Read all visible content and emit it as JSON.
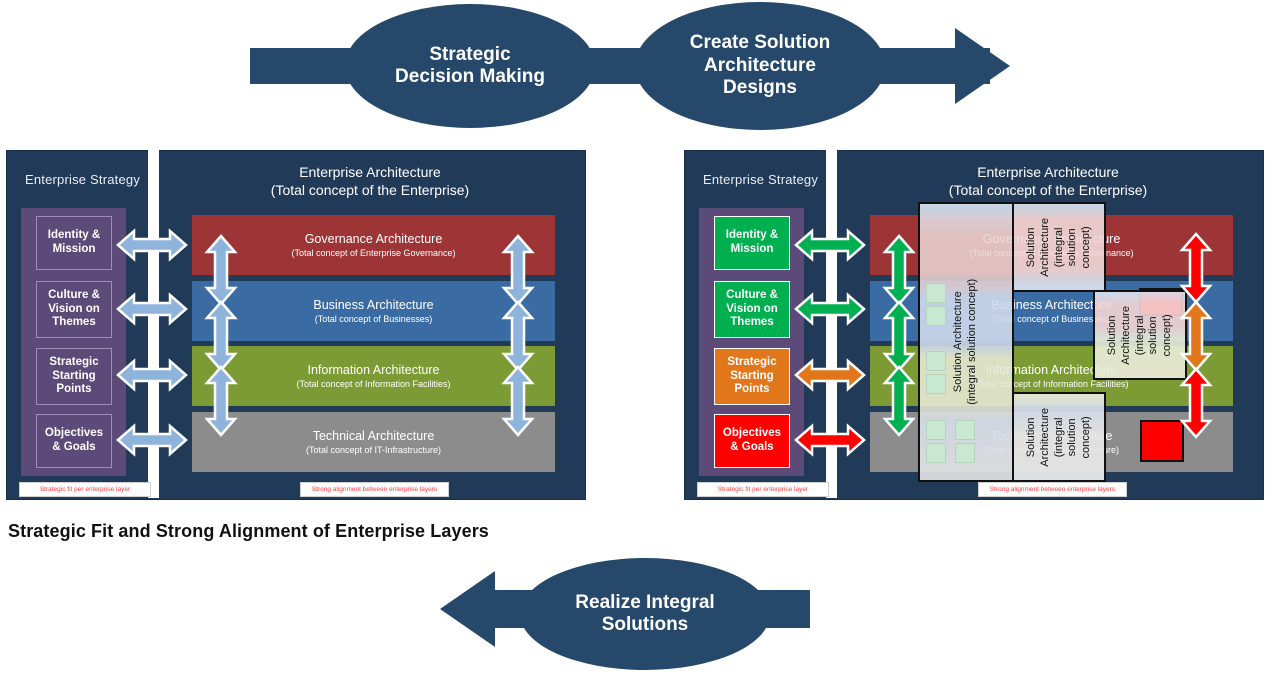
{
  "process": {
    "top": {
      "step1": "Strategic\nDecision Making",
      "step1_line1": "Strategic",
      "step1_line2": "Decision Making",
      "step2_line1": "Create Solution",
      "step2_line2": "Architecture",
      "step2_line3": "Designs",
      "color": "#26486b"
    },
    "bottom": {
      "line1": "Realize Integral",
      "line2": "Solutions",
      "color": "#26486b"
    }
  },
  "caption": "Strategic Fit and Strong Alignment of Enterprise Layers",
  "panels": {
    "left": {
      "strategy_title": "Enterprise Strategy",
      "ea_title_line1": "Enterprise Architecture",
      "ea_title_line2": "(Total concept of the Enterprise)",
      "strategy_items": [
        {
          "label_line1": "Identity &",
          "label_line2": "Mission",
          "color": "transparent"
        },
        {
          "label_line1": "Culture &",
          "label_line2": "Vision on",
          "label_line3": "Themes",
          "color": "transparent"
        },
        {
          "label_line1": "Strategic",
          "label_line2": "Starting",
          "label_line3": "Points",
          "color": "transparent"
        },
        {
          "label_line1": "Objectives",
          "label_line2": "& Goals",
          "color": "transparent"
        }
      ],
      "layers": [
        {
          "title": "Governance Architecture",
          "subtitle": "(Total concept of Enterprise Governance)",
          "color": "#9d3536"
        },
        {
          "title": "Business Architecture",
          "subtitle": "(Total concept of Businesses)",
          "color": "#3a6ca3"
        },
        {
          "title": "Information Architecture",
          "subtitle": "(Total concept of Information Facilities)",
          "color": "#7d9b35"
        },
        {
          "title": "Technical Architecture",
          "subtitle": "(Total concept of IT-Infrastructure)",
          "color": "#8c8c8c"
        }
      ],
      "h_arrow_colors": [
        "#8fb4dc",
        "#8fb4dc",
        "#8fb4dc",
        "#8fb4dc"
      ],
      "v_arrow_colors_left": [
        "#8fb4dc",
        "#8fb4dc",
        "#8fb4dc"
      ],
      "v_arrow_colors_right": [
        "#8fb4dc",
        "#8fb4dc",
        "#8fb4dc"
      ],
      "note_strategy": "Strategic fit per enterprise layer",
      "note_alignment": "Strong alignment between enterprise layers"
    },
    "right": {
      "strategy_title": "Enterprise Strategy",
      "ea_title_line1": "Enterprise Architecture",
      "ea_title_line2": "(Total concept of the Enterprise)",
      "strategy_items": [
        {
          "label_line1": "Identity &",
          "label_line2": "Mission",
          "color": "#00b050"
        },
        {
          "label_line1": "Culture &",
          "label_line2": "Vision on",
          "label_line3": "Themes",
          "color": "#00b050"
        },
        {
          "label_line1": "Strategic",
          "label_line2": "Starting",
          "label_line3": "Points",
          "color": "#e1761a"
        },
        {
          "label_line1": "Objectives",
          "label_line2": "& Goals",
          "color": "#ff0000"
        }
      ],
      "layers": [
        {
          "title": "Governance Architecture",
          "subtitle": "(Total concept of Enterprise Governance)",
          "color": "#9d3536"
        },
        {
          "title": "Business Architecture",
          "subtitle": "(Total concept of Businesses)",
          "color": "#3a6ca3"
        },
        {
          "title": "Information Architecture",
          "subtitle": "(Total concept of Information Facilities)",
          "color": "#7d9b35"
        },
        {
          "title": "Technical Architecture",
          "subtitle": "(Total concept of IT-Infrastructure)",
          "color": "#8c8c8c"
        }
      ],
      "h_arrow_colors": [
        "#00b050",
        "#00b050",
        "#e1761a",
        "#ff0000"
      ],
      "v_arrow_colors_left": [
        "#00b050",
        "#00b050",
        "#00b050"
      ],
      "v_arrow_colors_right": [
        "#ff0000",
        "#e1761a",
        "#ff0000"
      ],
      "note_strategy": "Strategic fit per enterprise layer",
      "note_alignment": "Strong alignment between enterprise layers",
      "solution_cards": [
        {
          "line1": "Solution Architecture",
          "line2": "(integral solution concept)"
        },
        {
          "line1": "Solution",
          "line2": "Architecture",
          "line3": "(integral",
          "line4": "solution",
          "line5": "concept)"
        },
        {
          "line1": "Solution",
          "line2": "Architecture",
          "line3": "(integral",
          "line4": "solution",
          "line5": "concept)"
        },
        {
          "line1": "Solution",
          "line2": "Architecture",
          "line3": "(integral",
          "line4": "solution",
          "line5": "concept)"
        }
      ]
    }
  },
  "colors": {
    "panel_bg": "#203a58",
    "strategy_col": "#5c4a78",
    "process_navy": "#26486b",
    "accent_green": "#00b050",
    "accent_orange": "#e1761a",
    "accent_red": "#ff0000",
    "light_blue_arrow": "#8fb4dc"
  }
}
